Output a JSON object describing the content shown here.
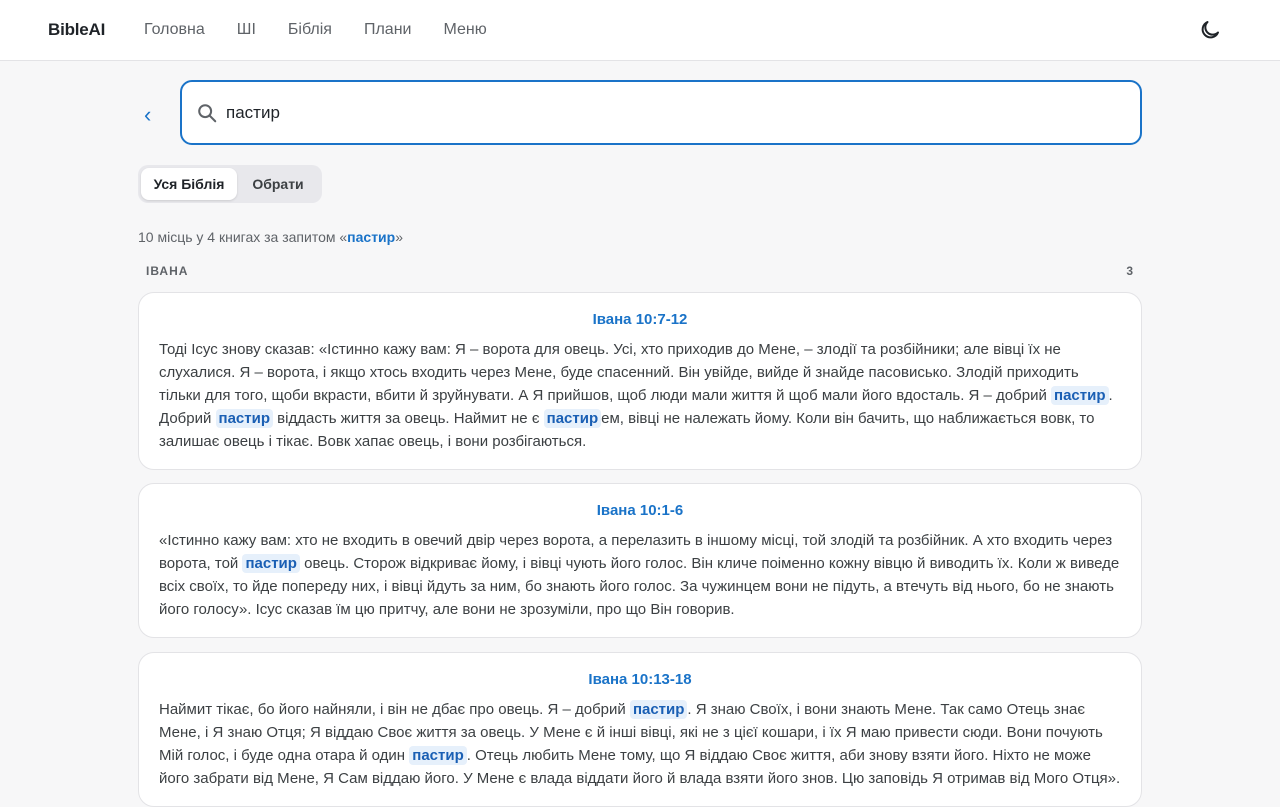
{
  "app": {
    "logo": "BibleAI"
  },
  "nav": {
    "items": [
      "Головна",
      "ШІ",
      "Біблія",
      "Плани",
      "Меню"
    ]
  },
  "icons": {
    "theme": "moon-icon",
    "search": "search-icon",
    "back": "chevron-left-icon"
  },
  "colors": {
    "accent": "#1a73c8",
    "highlight_bg": "#e6f0fb"
  },
  "search": {
    "back_label": "‹",
    "value": "пастир",
    "placeholder": ""
  },
  "scope": {
    "all": "Уся Біблія",
    "choose": "Обрати"
  },
  "summary": {
    "prefix": "10 місць у 4 книгах за запитом «",
    "query": "пастир",
    "suffix": "»"
  },
  "book": {
    "name": "ІВАНА",
    "count": "3"
  },
  "results": [
    {
      "ref": "Івана 10:7-12",
      "segments": [
        {
          "t": "Тоді Ісус знову сказав: «Істинно кажу вам: Я – ворота для овець. Усі, хто приходив до Мене, – злодії та розбійники; але вівці їх не слухалися. Я – ворота, і якщо хтось входить через Мене, буде спасенний. Він увійде, вийде й знайде пасовисько. Злодій приходить тільки для того, щоби вкрасти, вбити й зруйнувати. А Я прийшов, щоб люди мали життя й щоб мали його вдосталь. Я – добрий "
        },
        {
          "t": "пастир",
          "hl": true
        },
        {
          "t": ". Добрий "
        },
        {
          "t": "пастир",
          "hl": true
        },
        {
          "t": " віддасть життя за овець. Наймит не є "
        },
        {
          "t": "пастир",
          "hl": true
        },
        {
          "t": "ем, вівці не належать йому. Коли він бачить, що наближається вовк, то залишає овець і тікає. Вовк хапає овець, і вони розбігаються."
        }
      ]
    },
    {
      "ref": "Івана 10:1-6",
      "segments": [
        {
          "t": "«Істинно кажу вам: хто не входить в овечий двір через ворота, а перелазить в іншому місці, той злодій та розбійник. А хто входить через ворота, той "
        },
        {
          "t": "пастир",
          "hl": true
        },
        {
          "t": " овець. Сторож відкриває йому, і вівці чують його голос. Він кличе поіменно кожну вівцю й виводить їх. Коли ж виведе всіх своїх, то йде попереду них, і вівці йдуть за ним, бо знають його голос. За чужинцем вони не підуть, а втечуть від нього, бо не знають його голосу». Ісус сказав їм цю притчу, але вони не зрозуміли, про що Він говорив."
        }
      ]
    },
    {
      "ref": "Івана 10:13-18",
      "segments": [
        {
          "t": "Наймит тікає, бо його найняли, і він не дбає про овець. Я – добрий "
        },
        {
          "t": "пастир",
          "hl": true
        },
        {
          "t": ". Я знаю Своїх, і вони знають Мене. Так само Отець знає Мене, і Я знаю Отця; Я віддаю Своє життя за овець. У Мене є й інші вівці, які не з цієї кошари, і їх Я маю привести сюди. Вони почують Мій голос, і буде одна отара й один "
        },
        {
          "t": "пастир",
          "hl": true
        },
        {
          "t": ". Отець любить Мене тому, що Я віддаю Своє життя, аби знову взяти його. Ніхто не може його забрати від Мене, Я Сам віддаю його. У Мене є влада віддати його й влада взяти його знов. Цю заповідь Я отримав від Мого Отця»."
        }
      ]
    }
  ]
}
